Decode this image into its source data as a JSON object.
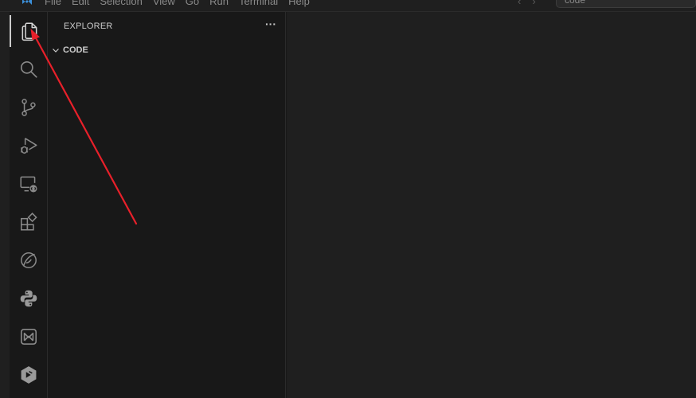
{
  "titlebar": {
    "menu": [
      "File",
      "Edit",
      "Selection",
      "View",
      "Go",
      "Run",
      "Terminal",
      "Help"
    ],
    "command_center_text": "code"
  },
  "activity_bar": {
    "items": [
      {
        "icon": "files-icon",
        "active": true
      },
      {
        "icon": "search-icon"
      },
      {
        "icon": "source-control-icon"
      },
      {
        "icon": "run-debug-icon"
      },
      {
        "icon": "remote-explorer-icon"
      },
      {
        "icon": "extensions-icon"
      },
      {
        "icon": "leaf-extension-icon"
      },
      {
        "icon": "python-icon"
      },
      {
        "icon": "m-logo-extension-icon"
      },
      {
        "icon": "hexagon-extension-icon"
      }
    ]
  },
  "sidebar": {
    "title": "EXPLORER",
    "more_actions": "···",
    "folder": {
      "label": "CODE",
      "expanded": true
    }
  },
  "colors": {
    "background": "#181818",
    "editor": "#1f1f1f",
    "annotation_arrow": "#e8202a"
  }
}
